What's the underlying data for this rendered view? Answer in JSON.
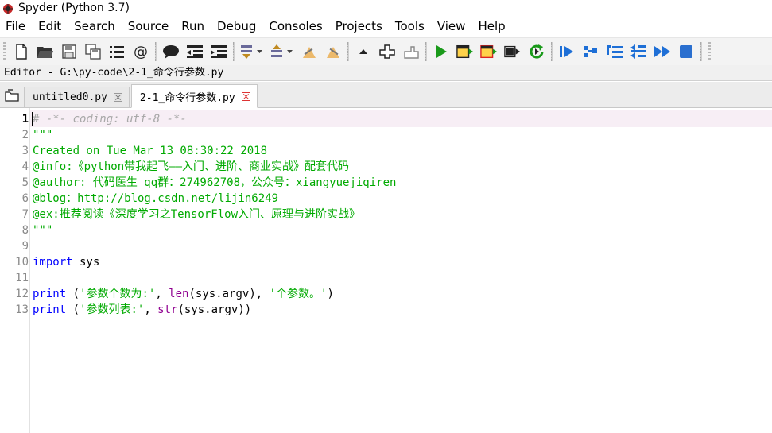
{
  "window": {
    "title": "Spyder (Python 3.7)",
    "app_icon": "spyder-icon"
  },
  "menu": [
    "File",
    "Edit",
    "Search",
    "Source",
    "Run",
    "Debug",
    "Consoles",
    "Projects",
    "Tools",
    "View",
    "Help"
  ],
  "toolbar": {
    "file_group": [
      "new-file-icon",
      "open-file-icon",
      "save-icon",
      "save-all-icon",
      "browse-tabs-icon",
      "at-icon"
    ],
    "edit_group": [
      "comment-icon",
      "unindent-icon",
      "indent-icon"
    ],
    "nav_group": [
      "previous-cursor-icon",
      "next-cursor-icon",
      "last-edit-icon",
      "warning-icon"
    ],
    "cell_group": [
      "up-arrow-icon",
      "maximize-pane-icon",
      "hand-icon"
    ],
    "run_group": [
      "run-icon",
      "run-cell-icon",
      "run-cell-advance-icon",
      "run-selection-icon",
      "rerun-icon"
    ],
    "debug_group": [
      "debug-icon",
      "step-icon",
      "step-into-icon",
      "step-return-icon",
      "continue-icon",
      "stop-icon"
    ],
    "colors": {
      "run_green": "#1a9a1a",
      "debug_blue": "#1e6fd6",
      "stop_blue": "#2a6fcf"
    }
  },
  "editor": {
    "label": "Editor - G:\\py-code\\2-1_命令行参数.py",
    "tabs": [
      {
        "label": "untitled0.py",
        "active": false
      },
      {
        "label": "2-1_命令行参数.py",
        "active": true
      }
    ],
    "current_line": 1,
    "lines": [
      {
        "n": "1",
        "parts": [
          {
            "t": "# -*- coding: utf-8 -*-",
            "c": "comment"
          }
        ]
      },
      {
        "n": "2",
        "parts": [
          {
            "t": "\"\"\"",
            "c": "string"
          }
        ]
      },
      {
        "n": "3",
        "parts": [
          {
            "t": "Created on Tue Mar 13 08:30:22 2018",
            "c": "string"
          }
        ]
      },
      {
        "n": "4",
        "parts": [
          {
            "t": "@info:《python带我起飞——入门、进阶、商业实战》配套代码",
            "c": "string"
          }
        ]
      },
      {
        "n": "5",
        "parts": [
          {
            "t": "@author: 代码医生 qq群：274962708，公众号：xiangyuejiqiren",
            "c": "string"
          }
        ]
      },
      {
        "n": "6",
        "parts": [
          {
            "t": "@blog：http://blog.csdn.net/lijin6249",
            "c": "string"
          }
        ]
      },
      {
        "n": "7",
        "parts": [
          {
            "t": "@ex:推荐阅读《深度学习之TensorFlow入门、原理与进阶实战》",
            "c": "string"
          }
        ]
      },
      {
        "n": "8",
        "parts": [
          {
            "t": "\"\"\"",
            "c": "string"
          }
        ]
      },
      {
        "n": "9",
        "parts": []
      },
      {
        "n": "10",
        "parts": [
          {
            "t": "import",
            "c": "keyword"
          },
          {
            "t": " sys",
            "c": "default"
          }
        ]
      },
      {
        "n": "11",
        "parts": []
      },
      {
        "n": "12",
        "parts": [
          {
            "t": "print",
            "c": "keyword"
          },
          {
            "t": " (",
            "c": "default"
          },
          {
            "t": "'参数个数为:'",
            "c": "string"
          },
          {
            "t": ", ",
            "c": "default"
          },
          {
            "t": "len",
            "c": "builtin"
          },
          {
            "t": "(sys.argv), ",
            "c": "default"
          },
          {
            "t": "'个参数。'",
            "c": "string"
          },
          {
            "t": ")",
            "c": "default"
          }
        ]
      },
      {
        "n": "13",
        "parts": [
          {
            "t": "print",
            "c": "keyword"
          },
          {
            "t": " (",
            "c": "default"
          },
          {
            "t": "'参数列表:'",
            "c": "string"
          },
          {
            "t": ", ",
            "c": "default"
          },
          {
            "t": "str",
            "c": "builtin"
          },
          {
            "t": "(sys.argv))",
            "c": "default"
          }
        ]
      }
    ]
  }
}
